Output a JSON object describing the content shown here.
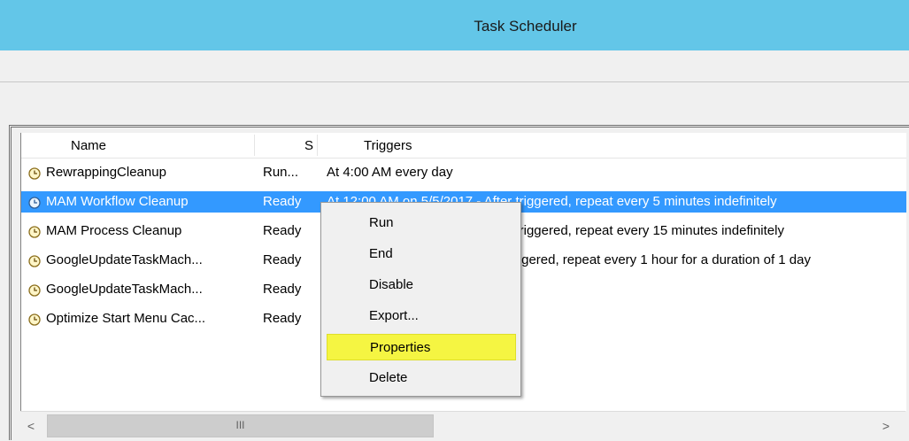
{
  "window": {
    "title": "Task Scheduler"
  },
  "task_list": {
    "columns": {
      "name": "Name",
      "status": "S",
      "triggers": "Triggers"
    },
    "rows": [
      {
        "name": "RewrappingCleanup",
        "status": "Run...",
        "triggers": "At 4:00 AM every day"
      },
      {
        "name": "MAM Workflow Cleanup",
        "status": "Ready",
        "triggers": "At 12:00 AM on 5/5/2017 - After triggered, repeat every 5 minutes indefinitely"
      },
      {
        "name": "MAM Process Cleanup",
        "status": "Ready",
        "triggers": "At 12:00 AM on 5/5/2017 - After triggered, repeat every 15 minutes indefinitely"
      },
      {
        "name": "GoogleUpdateTaskMach...",
        "status": "Ready",
        "triggers": "At 12:00 AM every day - After triggered, repeat every 1 hour for a duration of 1 day"
      },
      {
        "name": "GoogleUpdateTaskMach...",
        "status": "Ready",
        "triggers": ""
      },
      {
        "name": "Optimize Start Menu Cac...",
        "status": "Ready",
        "triggers": ""
      }
    ]
  },
  "context_menu": {
    "items": [
      {
        "label": "Run"
      },
      {
        "label": "End"
      },
      {
        "label": "Disable"
      },
      {
        "label": "Export..."
      },
      {
        "label": "Properties",
        "highlighted": true
      },
      {
        "label": "Delete"
      }
    ]
  },
  "scrollbar": {
    "left_arrow": "<",
    "right_arrow": ">",
    "thumb_grip": "III"
  },
  "colors": {
    "titlebar": "#63c6e8",
    "selection": "#3399ff",
    "menu_highlight": "#f5f542"
  },
  "icons": {
    "task": "clock-icon"
  }
}
